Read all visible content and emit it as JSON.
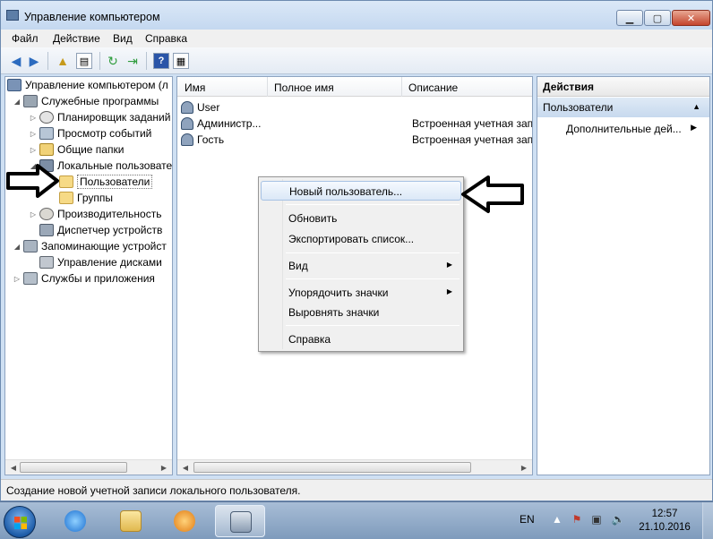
{
  "window": {
    "title": "Управление компьютером",
    "controls": {
      "minimize": "▁",
      "maximize": "▢",
      "close": "✕"
    }
  },
  "menubar": [
    "Файл",
    "Действие",
    "Вид",
    "Справка"
  ],
  "tree": {
    "root": "Управление компьютером (л",
    "system_tools": "Служебные программы",
    "task_scheduler": "Планировщик заданий",
    "event_viewer": "Просмотр событий",
    "shared_folders": "Общие папки",
    "local_users": "Локальные пользовате",
    "users": "Пользователи",
    "groups": "Группы",
    "performance": "Производительность",
    "device_manager": "Диспетчер устройств",
    "storage": "Запоминающие устройст",
    "disk_management": "Управление дисками",
    "services_apps": "Службы и приложения"
  },
  "list": {
    "columns": [
      "Имя",
      "Полное имя",
      "Описание"
    ],
    "rows": [
      {
        "name": "User",
        "full_name": "",
        "description": ""
      },
      {
        "name": "Администр...",
        "full_name": "",
        "description": "Встроенная учетная запи"
      },
      {
        "name": "Гость",
        "full_name": "",
        "description": "Встроенная учетная запи"
      }
    ]
  },
  "actions": {
    "title": "Действия",
    "group": "Пользователи",
    "item": "Дополнительные дей..."
  },
  "context_menu": {
    "new_user": "Новый пользователь...",
    "refresh": "Обновить",
    "export": "Экспортировать список...",
    "view": "Вид",
    "arrange": "Упорядочить значки",
    "align": "Выровнять значки",
    "help": "Справка"
  },
  "status": "Создание новой учетной записи локального пользователя.",
  "taskbar": {
    "lang": "EN",
    "time": "12:57",
    "date": "21.10.2016"
  },
  "colors": {
    "window_frame": "#cfe0f3",
    "highlight": "#dbe8f7",
    "taskbar": "#8fa9c8"
  }
}
